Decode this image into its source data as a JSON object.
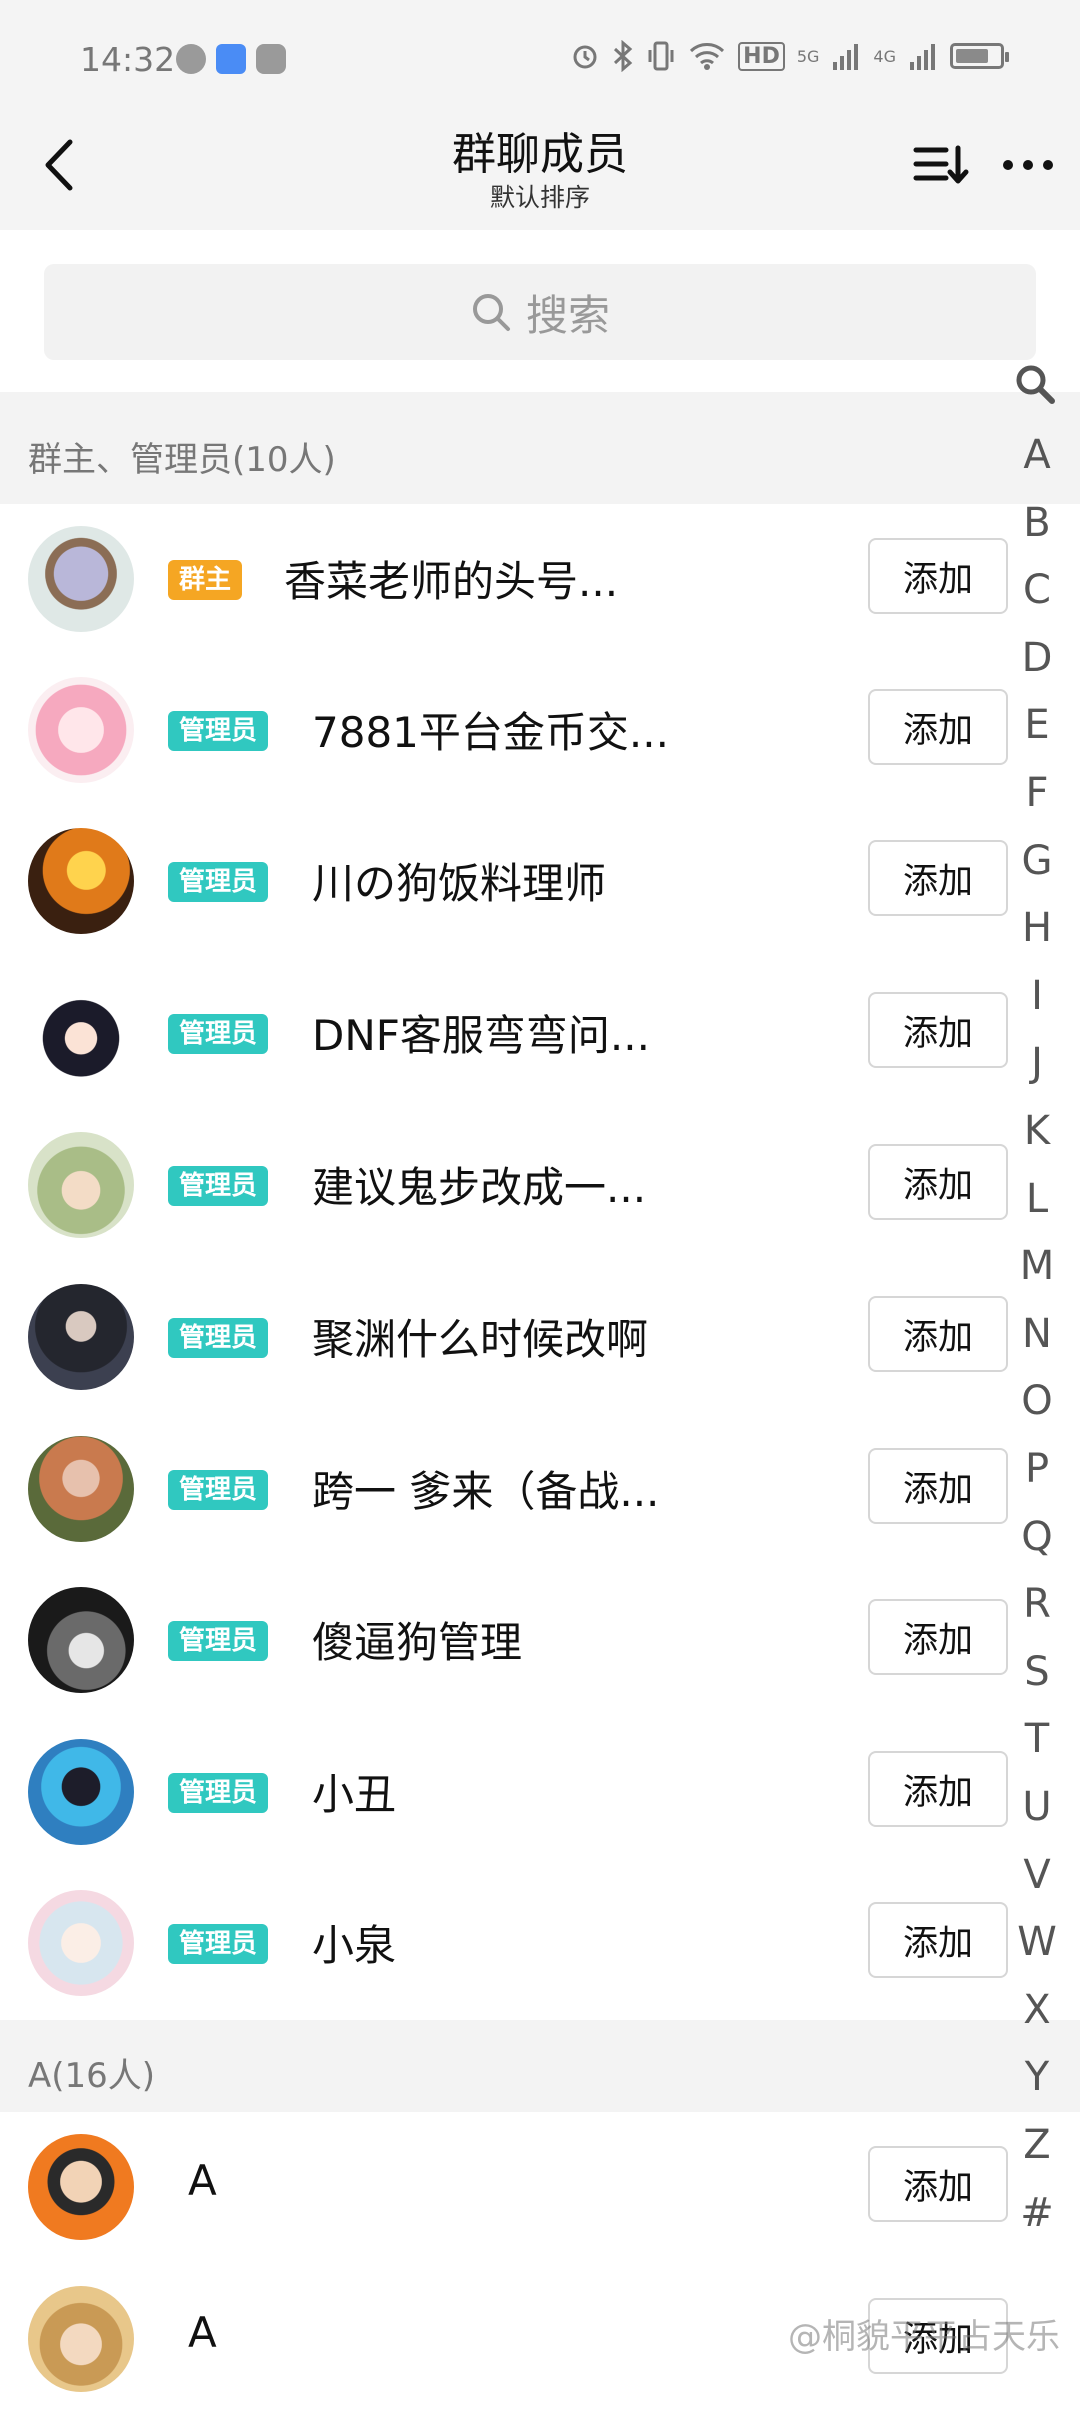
{
  "status_bar": {
    "time": "14:32",
    "network_labels": [
      "HD",
      "5G",
      "4G"
    ],
    "battery_level": 0.75
  },
  "header": {
    "title": "群聊成员",
    "subtitle": "默认排序"
  },
  "search": {
    "placeholder": "搜索"
  },
  "sections": [
    {
      "label": "群主、管理员(10人)",
      "members": [
        {
          "badge": "群主",
          "role": "owner",
          "name": "香菜老师的头号...",
          "button": "添加"
        },
        {
          "badge": "管理员",
          "role": "admin",
          "name": "7881平台金币交...",
          "button": "添加"
        },
        {
          "badge": "管理员",
          "role": "admin",
          "name": "川の狗饭料理师",
          "button": "添加"
        },
        {
          "badge": "管理员",
          "role": "admin",
          "name": "DNF客服弯弯问...",
          "button": "添加"
        },
        {
          "badge": "管理员",
          "role": "admin",
          "name": "建议鬼步改成一...",
          "button": "添加"
        },
        {
          "badge": "管理员",
          "role": "admin",
          "name": "聚渊什么时候改啊",
          "button": "添加"
        },
        {
          "badge": "管理员",
          "role": "admin",
          "name": "跨一 爹来（备战...",
          "button": "添加"
        },
        {
          "badge": "管理员",
          "role": "admin",
          "name": "傻逼狗管理",
          "button": "添加"
        },
        {
          "badge": "管理员",
          "role": "admin",
          "name": "小丑",
          "button": "添加"
        },
        {
          "badge": "管理员",
          "role": "admin",
          "name": "小泉",
          "button": "添加"
        }
      ]
    },
    {
      "label": "A(16人)",
      "members": [
        {
          "name": "A",
          "button": "添加"
        },
        {
          "name": "A",
          "button": "添加"
        }
      ]
    }
  ],
  "index_letters": [
    "A",
    "B",
    "C",
    "D",
    "E",
    "F",
    "G",
    "H",
    "I",
    "J",
    "K",
    "L",
    "M",
    "N",
    "O",
    "P",
    "Q",
    "R",
    "S",
    "T",
    "U",
    "V",
    "W",
    "X",
    "Y",
    "Z",
    "#"
  ],
  "watermark": "@桐貌平平占天乐",
  "colors": {
    "owner_badge": "#f5a623",
    "admin_badge": "#30c8c0",
    "section_bg": "#f3f3f3"
  }
}
